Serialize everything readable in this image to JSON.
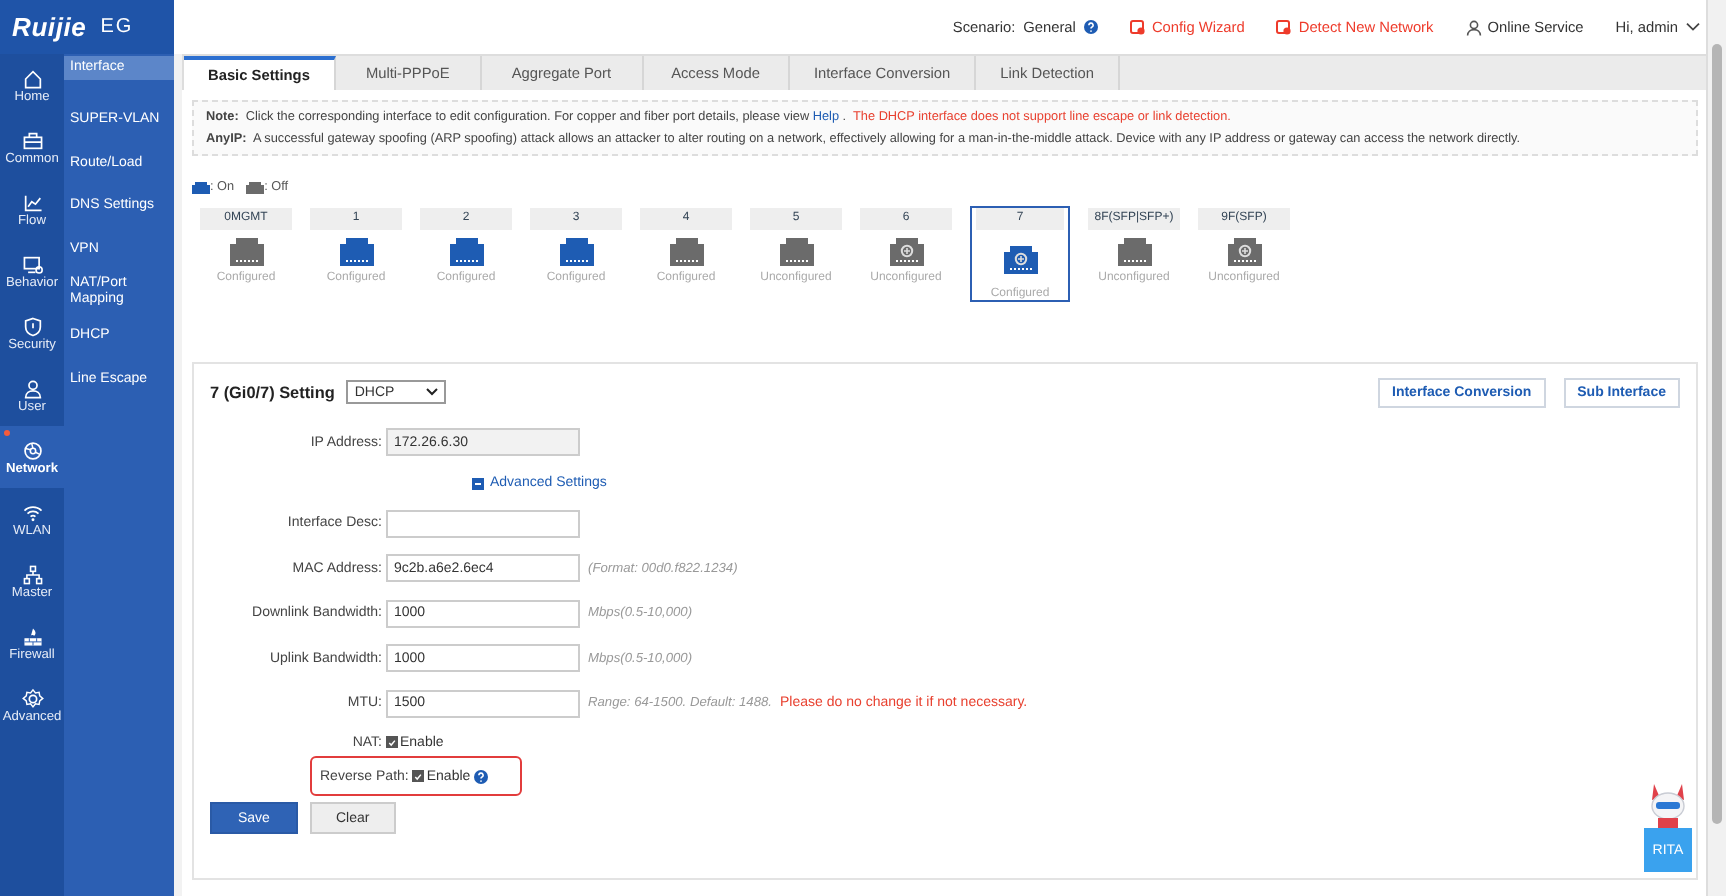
{
  "brand": {
    "logo": "Ruijie",
    "product": "EG"
  },
  "header": {
    "scenario_label": "Scenario:",
    "scenario": "General",
    "links": [
      {
        "label": "Config Wizard",
        "kind": "alert"
      },
      {
        "label": "Detect New Network",
        "kind": "alert"
      },
      {
        "label": "Online Service",
        "kind": "person"
      }
    ],
    "user": "Hi, admin"
  },
  "nav": [
    {
      "label": "Home",
      "selected": false,
      "badge": false
    },
    {
      "label": "Common",
      "selected": false,
      "badge": false
    },
    {
      "label": "Flow",
      "selected": false,
      "badge": false
    },
    {
      "label": "Behavior",
      "selected": false,
      "badge": false
    },
    {
      "label": "Security",
      "selected": false,
      "badge": false
    },
    {
      "label": "User",
      "selected": false,
      "badge": false
    },
    {
      "label": "Network",
      "selected": true,
      "badge": true
    },
    {
      "label": "WLAN",
      "selected": false,
      "badge": false
    },
    {
      "label": "Master",
      "selected": false,
      "badge": false
    },
    {
      "label": "Firewall",
      "selected": false,
      "badge": false
    },
    {
      "label": "Advanced",
      "selected": false,
      "badge": false
    }
  ],
  "subnav": [
    {
      "label": "Interface",
      "selected": true
    },
    {
      "label": "SUPER-VLAN",
      "selected": false
    },
    {
      "label": "Route/Load",
      "selected": false
    },
    {
      "label": "DNS Settings",
      "selected": false
    },
    {
      "label": "VPN",
      "selected": false
    },
    {
      "label": "NAT/Port Mapping",
      "selected": false
    },
    {
      "label": "DHCP",
      "selected": false
    },
    {
      "label": "Line Escape",
      "selected": false
    }
  ],
  "tabs": [
    {
      "label": "Basic Settings",
      "selected": true
    },
    {
      "label": "Multi-PPPoE",
      "selected": false
    },
    {
      "label": "Aggregate Port",
      "selected": false
    },
    {
      "label": "Access Mode",
      "selected": false
    },
    {
      "label": "Interface Conversion",
      "selected": false
    },
    {
      "label": "Link Detection",
      "selected": false
    }
  ],
  "notes": [
    {
      "label": "Note:",
      "text": "Click the corresponding interface to edit configuration. For copper and fiber port details, please view ",
      "link": "Help",
      "after": " .",
      "warning": "The DHCP interface does not support line escape or link detection."
    },
    {
      "label": "AnyIP:",
      "text": "A successful gateway spoofing (ARP spoofing) attack allows an attacker to alter routing on a network, effectively allowing for a man-in-the-middle attack. Device with any IP address or gateway can access the network directly."
    }
  ],
  "legend": [
    {
      "label": ": On",
      "on": true
    },
    {
      "label": ": Off",
      "on": false
    }
  ],
  "ports": [
    {
      "label": "0MGMT",
      "on": false,
      "kind": "copper",
      "status": "Configured",
      "selected": false
    },
    {
      "label": "1",
      "on": true,
      "kind": "copper",
      "status": "Configured",
      "selected": false
    },
    {
      "label": "2",
      "on": true,
      "kind": "copper",
      "status": "Configured",
      "selected": false
    },
    {
      "label": "3",
      "on": true,
      "kind": "copper",
      "status": "Configured",
      "selected": false
    },
    {
      "label": "4",
      "on": false,
      "kind": "copper",
      "status": "Configured",
      "selected": false
    },
    {
      "label": "5",
      "on": false,
      "kind": "copper",
      "status": "Unconfigured",
      "selected": false
    },
    {
      "label": "6",
      "on": false,
      "kind": "combo",
      "status": "Unconfigured",
      "selected": false
    },
    {
      "label": "7",
      "on": true,
      "kind": "combo",
      "status": "Configured",
      "selected": true
    },
    {
      "label": "8F(SFP|SFP+)",
      "on": false,
      "kind": "copper",
      "status": "Unconfigured",
      "selected": false
    },
    {
      "label": "9F(SFP)",
      "on": false,
      "kind": "combo",
      "status": "Unconfigured",
      "selected": false
    }
  ],
  "setting": {
    "title": "7 (Gi0/7) Setting",
    "mode": "DHCP",
    "buttons": [
      "Interface Conversion",
      "Sub Interface"
    ],
    "rows": [
      {
        "kind": "input",
        "label": "IP Address:",
        "value": "172.26.6.30",
        "disabled": true
      },
      {
        "kind": "link",
        "label": "Advanced Settings"
      },
      {
        "kind": "input",
        "label": "Interface Desc:",
        "disabled": false
      },
      {
        "kind": "input",
        "label": "MAC Address:",
        "value": "9c2b.a6e2.6ec4",
        "disabled": false,
        "hint": "(Format: 00d0.f822.1234)"
      },
      {
        "kind": "input",
        "label": "Downlink Bandwidth:",
        "value": "1000",
        "disabled": false,
        "hint": "Mbps(0.5-10,000)"
      },
      {
        "kind": "input",
        "label": "Uplink Bandwidth:",
        "value": "1000",
        "disabled": false,
        "hint": "Mbps(0.5-10,000)"
      },
      {
        "kind": "input",
        "label": "MTU:",
        "value": "1500",
        "disabled": false,
        "hint": "Range: 64-1500. Default: 1488.",
        "warning": "Please do no change it if not necessary."
      },
      {
        "kind": "checkbox",
        "label": "NAT:",
        "text": "Enable",
        "checked": true,
        "help": false,
        "highlighted": false
      },
      {
        "kind": "checkbox",
        "label": "Reverse Path:",
        "text": "Enable",
        "checked": true,
        "help": true,
        "highlighted": true
      }
    ],
    "actions": [
      {
        "label": "Save",
        "kind": "primary"
      },
      {
        "label": "Clear",
        "kind": "secondary"
      }
    ]
  },
  "assistant": {
    "label": "RITA"
  }
}
